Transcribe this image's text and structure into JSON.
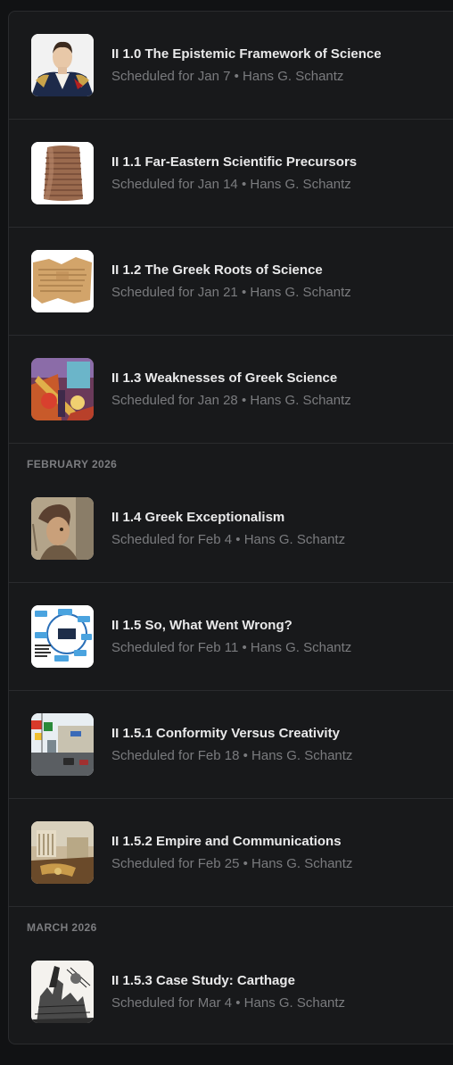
{
  "groups": [
    {
      "header": "",
      "items": [
        {
          "title": "II 1.0 The Epistemic Framework of Science",
          "date": "Scheduled for Jan 7",
          "author": "Hans G. Schantz",
          "thumb": "portrait-napoleon"
        },
        {
          "title": "II 1.1 Far-Eastern Scientific Precursors",
          "date": "Scheduled for Jan 14",
          "author": "Hans G. Schantz",
          "thumb": "clay-cylinder"
        },
        {
          "title": "II 1.2 The Greek Roots of Science",
          "date": "Scheduled for Jan 21",
          "author": "Hans G. Schantz",
          "thumb": "papyrus"
        },
        {
          "title": "II 1.3 Weaknesses of Greek Science",
          "date": "Scheduled for Jan 28",
          "author": "Hans G. Schantz",
          "thumb": "painting-colorful"
        }
      ]
    },
    {
      "header": "FEBRUARY 2026",
      "items": [
        {
          "title": "II 1.4 Greek Exceptionalism",
          "date": "Scheduled for Feb 4",
          "author": "Hans G. Schantz",
          "thumb": "mosaic-portrait"
        },
        {
          "title": "II 1.5 So, What Went Wrong?",
          "date": "Scheduled for Feb 11",
          "author": "Hans G. Schantz",
          "thumb": "flow-diagram"
        },
        {
          "title": "II 1.5.1 Conformity Versus Creativity",
          "date": "Scheduled for Feb 18",
          "author": "Hans G. Schantz",
          "thumb": "street-signs"
        },
        {
          "title": "II 1.5.2 Empire and Communications",
          "date": "Scheduled for Feb 25",
          "author": "Hans G. Schantz",
          "thumb": "empire-painting"
        }
      ]
    },
    {
      "header": "MARCH 2026",
      "items": [
        {
          "title": "II 1.5.3 Case Study: Carthage",
          "date": "Scheduled for Mar 4",
          "author": "Hans G. Schantz",
          "thumb": "engraving"
        }
      ]
    }
  ],
  "separator": " • "
}
